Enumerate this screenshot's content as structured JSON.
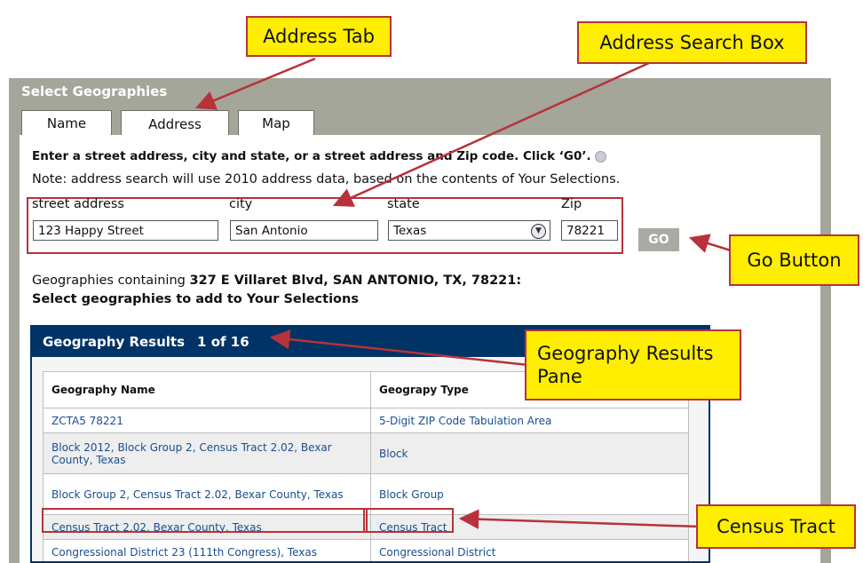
{
  "panel": {
    "title": "Select Geographies",
    "tabs": [
      {
        "label": "Name"
      },
      {
        "label": "Address",
        "active": true
      },
      {
        "label": "Map"
      }
    ]
  },
  "instructions": "Enter a street address, city and state, or a street address and Zip code. Click ‘G0’.",
  "note": "Note: address search will use 2010 address data, based on the contents of Your Selections.",
  "form": {
    "street_label": "street address",
    "street_value": "123 Happy Street",
    "city_label": "city",
    "city_value": "San Antonio",
    "state_label": "state",
    "state_value": "Texas",
    "zip_label": "Zip",
    "zip_value": "78221",
    "go_label": "GO"
  },
  "containing": {
    "prefix": "Geographies containing ",
    "address": "327 E Villaret Blvd, SAN ANTONIO, TX, 78221:",
    "instruction": "Select geographies to add to Your Selections"
  },
  "results": {
    "title": "Geography Results",
    "count": "1 of 16",
    "headers": [
      "Geography Name",
      "Geograpy Type"
    ],
    "rows": [
      {
        "name": "ZCTA5 78221",
        "type": "5-Digit ZIP Code Tabulation Area"
      },
      {
        "name": "Block 2012, Block Group 2, Census Tract 2.02, Bexar County, Texas",
        "type": "Block"
      },
      {
        "name": "Block Group 2, Census Tract 2.02, Bexar County, Texas",
        "type": "Block Group"
      },
      {
        "name": "Census Tract 2.02, Bexar County, Texas",
        "type": "Census Tract"
      },
      {
        "name": "Congressional District 23 (111th Congress), Texas",
        "type": "Congressional District"
      }
    ]
  },
  "callouts": {
    "address_tab": "Address Tab",
    "address_search_box": "Address Search Box",
    "go_button": "Go Button",
    "geography_results_pane_line1": "Geography Results",
    "geography_results_pane_line2": "Pane",
    "census_tract": "Census Tract"
  },
  "colors": {
    "panel_bg": "#a4a69a",
    "results_header": "#003366",
    "link": "#1a4d8f",
    "callout_fill": "#ffee00",
    "callout_border": "#b8323b"
  },
  "icons": {
    "help": "help-circle-icon",
    "select_arrow": "chevron-down-circle-icon"
  }
}
